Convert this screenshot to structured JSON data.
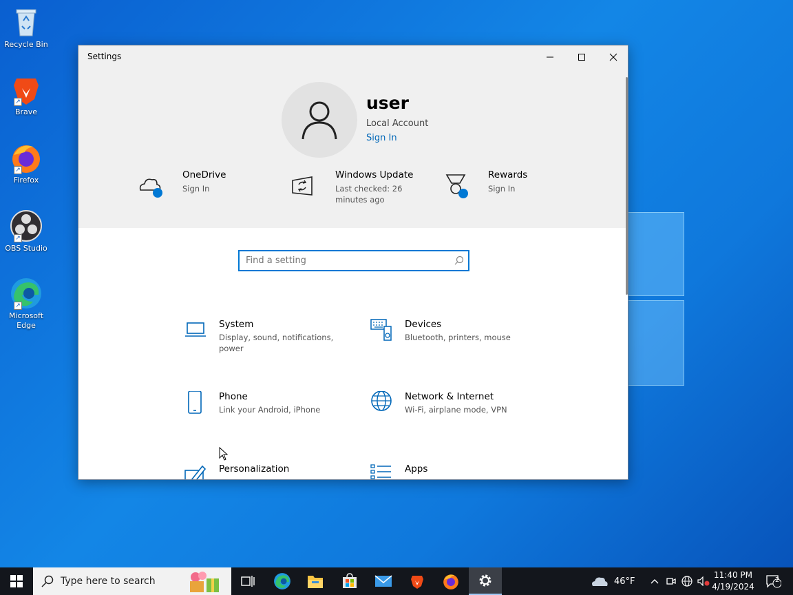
{
  "desktop": {
    "icons": [
      {
        "label": "Recycle Bin"
      },
      {
        "label": "Brave"
      },
      {
        "label": "Firefox"
      },
      {
        "label": "OBS Studio"
      },
      {
        "label": "Microsoft Edge"
      }
    ]
  },
  "window": {
    "title": "Settings",
    "user": {
      "name": "user",
      "account_type": "Local Account",
      "sign_in": "Sign In"
    },
    "quick_links": [
      {
        "title": "OneDrive",
        "subtitle": "Sign In",
        "icon": "cloud-icon"
      },
      {
        "title": "Windows Update",
        "subtitle": "Last checked: 26 minutes ago",
        "icon": "update-icon"
      },
      {
        "title": "Rewards",
        "subtitle": "Sign In",
        "icon": "medal-icon"
      }
    ],
    "search": {
      "placeholder": "Find a setting"
    },
    "categories": [
      {
        "title": "System",
        "subtitle": "Display, sound, notifications, power",
        "icon": "laptop-icon"
      },
      {
        "title": "Devices",
        "subtitle": "Bluetooth, printers, mouse",
        "icon": "keyboard-icon"
      },
      {
        "title": "Phone",
        "subtitle": "Link your Android, iPhone",
        "icon": "phone-icon"
      },
      {
        "title": "Network & Internet",
        "subtitle": "Wi-Fi, airplane mode, VPN",
        "icon": "globe-icon"
      },
      {
        "title": "Personalization",
        "subtitle": "",
        "icon": "brush-icon"
      },
      {
        "title": "Apps",
        "subtitle": "",
        "icon": "list-icon"
      }
    ],
    "accent": "#0078d4"
  },
  "taskbar": {
    "search_placeholder": "Type here to search",
    "weather": "46°F",
    "time": "11:40 PM",
    "date": "4/19/2024",
    "notification_count": "2"
  }
}
